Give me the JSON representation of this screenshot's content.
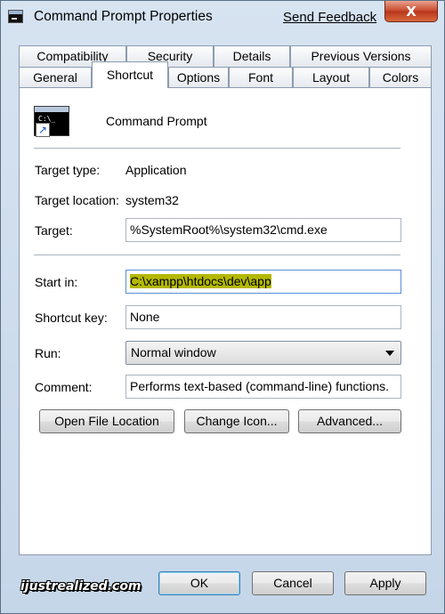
{
  "window": {
    "title": "Command Prompt Properties",
    "feedback_link": "Send Feedback",
    "close_glyph": "X"
  },
  "tabs": {
    "row_back": [
      "Compatibility",
      "Security",
      "Details",
      "Previous Versions"
    ],
    "row_front": [
      "General",
      "Shortcut",
      "Options",
      "Font",
      "Layout",
      "Colors"
    ],
    "active": "Shortcut"
  },
  "shortcut": {
    "name": "Command Prompt",
    "target_type_label": "Target type:",
    "target_type_value": "Application",
    "target_location_label": "Target location:",
    "target_location_value": "system32",
    "target_label": "Target:",
    "target_value": "%SystemRoot%\\system32\\cmd.exe",
    "start_in_label": "Start in:",
    "start_in_value": "C:\\xampp\\htdocs\\dev\\app",
    "shortcut_key_label": "Shortcut key:",
    "shortcut_key_value": "None",
    "run_label": "Run:",
    "run_value": "Normal window",
    "comment_label": "Comment:",
    "comment_value": "Performs text-based (command-line) functions."
  },
  "buttons": {
    "open_file_location": "Open File Location",
    "change_icon": "Change Icon...",
    "advanced": "Advanced...",
    "ok": "OK",
    "cancel": "Cancel",
    "apply": "Apply"
  },
  "watermark": "ijustrealized.com",
  "colors": {
    "selection_highlight": "#b3b800",
    "close_button": "#c6472a",
    "default_button_border": "#3c7fb1"
  }
}
